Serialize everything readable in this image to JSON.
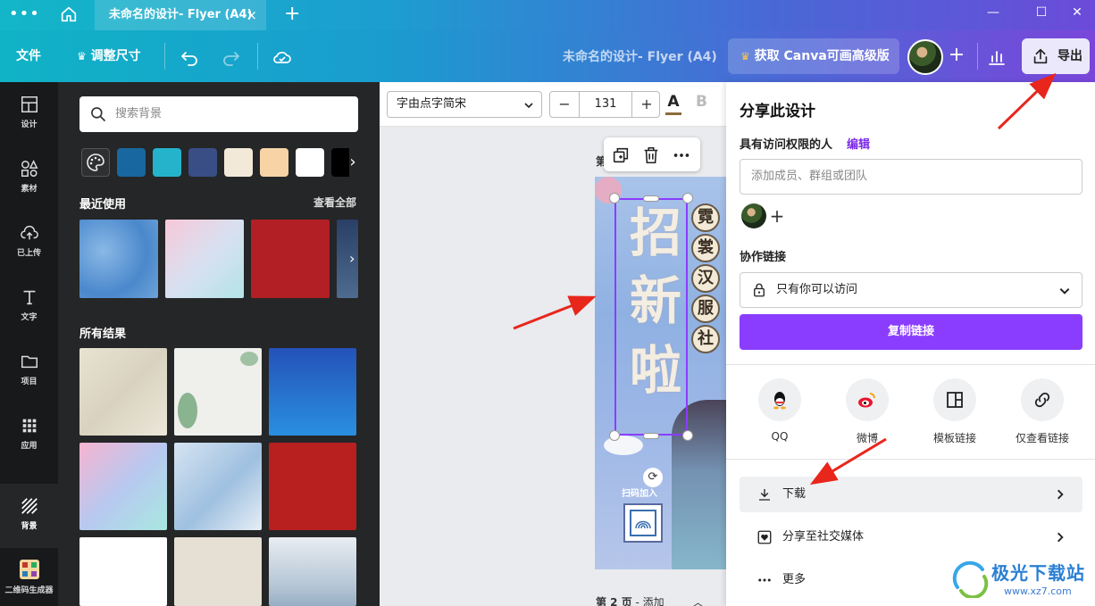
{
  "titlebar": {
    "tab_title": "未命名的设计- Flyer (A4)",
    "tab_close": "×",
    "new_tab": "+"
  },
  "toolbar": {
    "file": "文件",
    "resize": "调整尺寸",
    "doc_title": "未命名的设计- Flyer (A4)",
    "upgrade": "获取 Canva可画高级版",
    "add_member": "+",
    "export": "导出"
  },
  "rail": {
    "items": [
      {
        "label": "设计",
        "icon": "layout-icon"
      },
      {
        "label": "素材",
        "icon": "shapes-icon"
      },
      {
        "label": "已上传",
        "icon": "upload-icon"
      },
      {
        "label": "文字",
        "icon": "text-icon"
      },
      {
        "label": "项目",
        "icon": "folder-icon"
      },
      {
        "label": "应用",
        "icon": "apps-icon"
      },
      {
        "label": "背景",
        "icon": "background-icon"
      },
      {
        "label": "二维码生成器",
        "icon": "qr-app-icon"
      }
    ]
  },
  "panel": {
    "search_placeholder": "搜索背景",
    "swatches": [
      "#1967a0",
      "#25b3cc",
      "#3a4e86",
      "#f2e9d8",
      "#f8d3a6",
      "#ffffff",
      "#000000"
    ],
    "recent_title": "最近使用",
    "see_all": "查看全部",
    "all_results_title": "所有结果"
  },
  "editor": {
    "font": "字由点字简宋",
    "minus": "−",
    "font_size": "131",
    "plus": "+",
    "text_color_glyph": "A",
    "bold_glyph": "B"
  },
  "canvas": {
    "page1_label": "第",
    "page2_label_bold": "第 2 页",
    "page2_label_rest": " - 添加",
    "flyer": {
      "big_chars": [
        "招",
        "新",
        "啦"
      ],
      "circle_chars": [
        "霓",
        "裳",
        "汉",
        "服",
        "社"
      ],
      "qr_text": "扫码加入"
    }
  },
  "share": {
    "title": "分享此设计",
    "access_label": "具有访问权限的人",
    "edit": "编辑",
    "add_placeholder": "添加成员、群组或团队",
    "add_person": "+",
    "collab_label": "协作链接",
    "access_option": "只有你可以访问",
    "copy_link": "复制链接",
    "options": [
      {
        "label": "QQ",
        "icon": "qq-icon"
      },
      {
        "label": "微博",
        "icon": "weibo-icon"
      },
      {
        "label": "模板链接",
        "icon": "template-icon"
      },
      {
        "label": "仅查看链接",
        "icon": "link-icon"
      }
    ],
    "download": "下载",
    "social": "分享至社交媒体",
    "more": "更多"
  },
  "watermark": {
    "title": "极光下载站",
    "url": "www.xz7.com"
  },
  "colors": {
    "accent": "#8b3dff",
    "rail_bg": "#18191b",
    "panel_bg": "#252627",
    "arrow": "#e8261c"
  }
}
